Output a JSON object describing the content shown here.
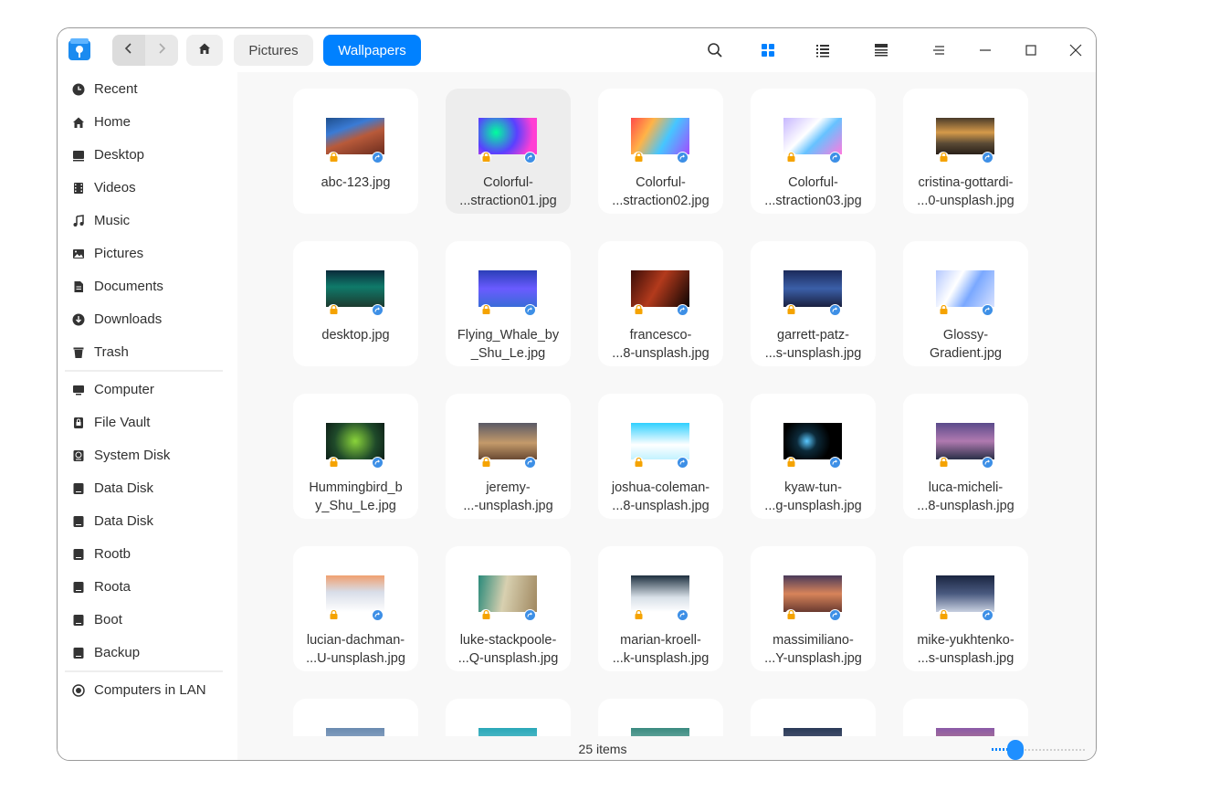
{
  "breadcrumb": [
    "Pictures",
    "Wallpapers"
  ],
  "toolbar": {
    "icons": [
      "search-icon",
      "icon-view-icon",
      "list-view-icon",
      "tree-view-icon",
      "menu-icon",
      "minimize-icon",
      "maximize-icon",
      "close-icon"
    ]
  },
  "sidebar": {
    "group1": [
      "Recent",
      "Home",
      "Desktop",
      "Videos",
      "Music",
      "Pictures",
      "Documents",
      "Downloads",
      "Trash"
    ],
    "group2": [
      "Computer",
      "File Vault",
      "System Disk",
      "Data Disk",
      "Data Disk",
      "Rootb",
      "Roota",
      "Boot",
      "Backup"
    ],
    "group3": [
      "Computers in LAN"
    ]
  },
  "files": [
    {
      "line1": "abc-123.jpg",
      "line2": ""
    },
    {
      "line1": "Colorful-",
      "line2": "...straction01.jpg"
    },
    {
      "line1": "Colorful-",
      "line2": "...straction02.jpg"
    },
    {
      "line1": "Colorful-",
      "line2": "...straction03.jpg"
    },
    {
      "line1": "cristina-gottardi-",
      "line2": "...0-unsplash.jpg"
    },
    {
      "line1": "desktop.jpg",
      "line2": ""
    },
    {
      "line1": "Flying_Whale_by",
      "line2": "_Shu_Le.jpg"
    },
    {
      "line1": "francesco-",
      "line2": "...8-unsplash.jpg"
    },
    {
      "line1": "garrett-patz-",
      "line2": "...s-unsplash.jpg"
    },
    {
      "line1": "Glossy-",
      "line2": "Gradient.jpg"
    },
    {
      "line1": "Hummingbird_b",
      "line2": "y_Shu_Le.jpg"
    },
    {
      "line1": "jeremy-",
      "line2": "...-unsplash.jpg"
    },
    {
      "line1": "joshua-coleman-",
      "line2": "...8-unsplash.jpg"
    },
    {
      "line1": "kyaw-tun-",
      "line2": "...g-unsplash.jpg"
    },
    {
      "line1": "luca-micheli-",
      "line2": "...8-unsplash.jpg"
    },
    {
      "line1": "lucian-dachman-",
      "line2": "...U-unsplash.jpg"
    },
    {
      "line1": "luke-stackpoole-",
      "line2": "...Q-unsplash.jpg"
    },
    {
      "line1": "marian-kroell-",
      "line2": "...k-unsplash.jpg"
    },
    {
      "line1": "massimiliano-",
      "line2": "...Y-unsplash.jpg"
    },
    {
      "line1": "mike-yukhtenko-",
      "line2": "...s-unsplash.jpg"
    },
    {
      "line1": "",
      "line2": ""
    },
    {
      "line1": "",
      "line2": ""
    },
    {
      "line1": "",
      "line2": ""
    },
    {
      "line1": "",
      "line2": ""
    },
    {
      "line1": "",
      "line2": ""
    }
  ],
  "selected_file_index": 1,
  "status": {
    "count_text": "25 items"
  },
  "zoom": {
    "level": 0.2
  },
  "colors": {
    "accent": "#0081ff",
    "lock": "#f5a300",
    "share": "#3d8fe6"
  }
}
